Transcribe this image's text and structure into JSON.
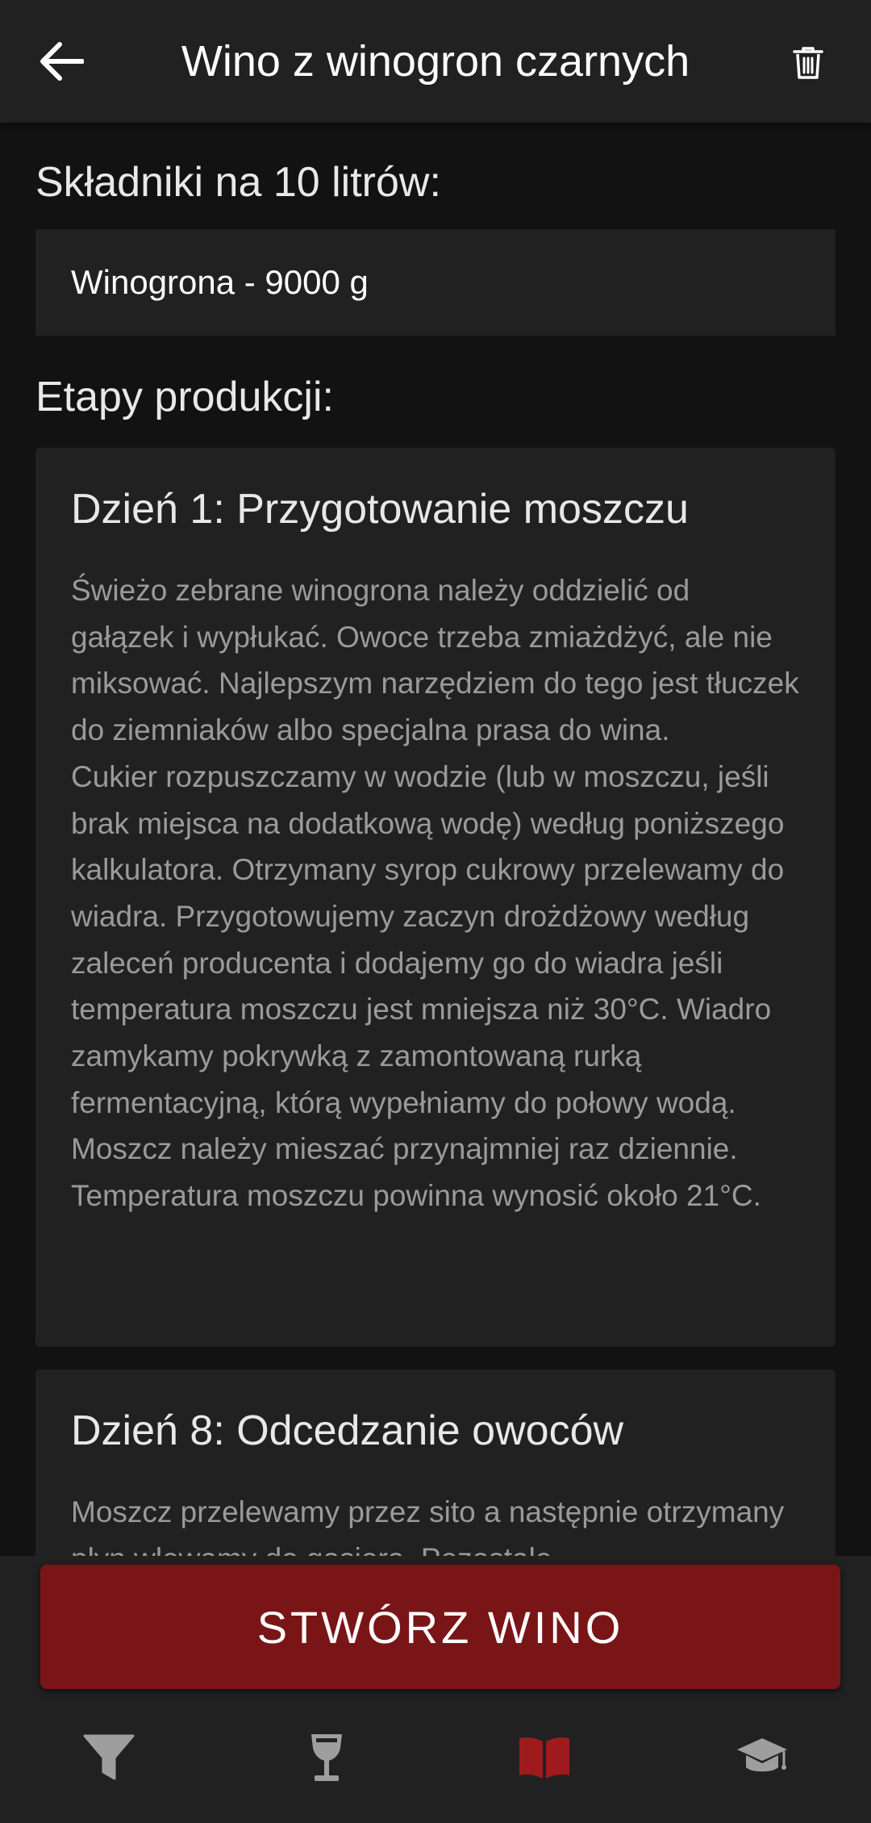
{
  "header": {
    "title": "Wino z winogron czarnych",
    "back_icon": "arrow-left-icon",
    "delete_icon": "trash-icon"
  },
  "ingredients": {
    "heading": "Składniki na 10 litrów:",
    "items": [
      "Winogrona - 9000 g"
    ]
  },
  "stages": {
    "heading": "Etapy produkcji:",
    "items": [
      {
        "title": "Dzień 1: Przygotowanie moszczu",
        "text": "Świeżo zebrane winogrona należy oddzielić od gałązek i wypłukać. Owoce trzeba zmiażdżyć, ale nie miksować. Najlepszym narzędziem do tego jest tłuczek do ziemniaków albo specjalna prasa do wina.\nCukier rozpuszczamy w wodzie (lub w moszczu, jeśli brak miejsca na dodatkową wodę) według poniższego kalkulatora. Otrzymany syrop cukrowy przelewamy do wiadra. Przygotowujemy zaczyn drożdżowy według zaleceń producenta i dodajemy go do wiadra jeśli temperatura moszczu jest mniejsza niż 30°C. Wiadro zamykamy pokrywką z zamontowaną rurką fermentacyjną, którą wypełniamy do połowy wodą. Moszcz należy mieszać przynajmniej raz dziennie. Temperatura moszczu powinna wynosić około 21°C."
      },
      {
        "title": "Dzień 8: Odcedzanie owoców",
        "text": "Moszcz przelewamy przez sito a następnie otrzymany płyn wlewamy do gąsiora. Pozostałe"
      }
    ]
  },
  "action": {
    "create_label": "STWÓRZ WINO"
  },
  "bottom_nav": {
    "items": [
      {
        "icon": "filter-icon",
        "active": false
      },
      {
        "icon": "wine-glass-icon",
        "active": false
      },
      {
        "icon": "book-icon",
        "active": true
      },
      {
        "icon": "graduation-cap-icon",
        "active": false
      }
    ]
  },
  "colors": {
    "accent": "#7a1517",
    "active_icon": "#9e1b1d",
    "inactive_icon": "#9e9e9e",
    "surface": "#212121",
    "background": "#121212"
  }
}
